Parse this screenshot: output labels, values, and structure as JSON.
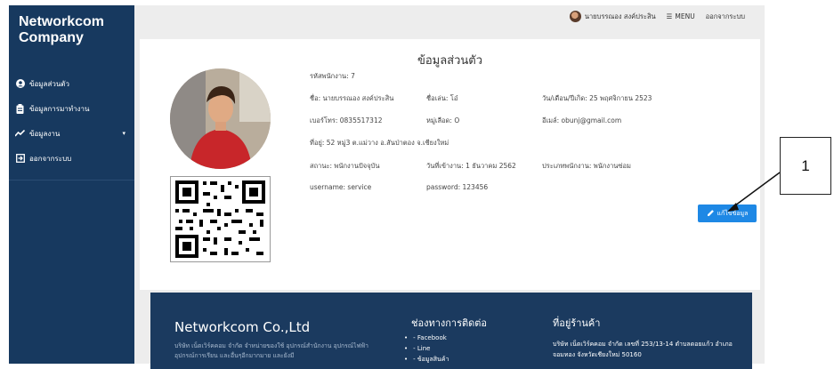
{
  "sidebar": {
    "brand_line1": "Networkcom",
    "brand_line2": "Company",
    "items": [
      {
        "label": "ข้อมูลส่วนตัว",
        "icon": "user-circle-icon"
      },
      {
        "label": "ข้อมูลการมาทำงาน",
        "icon": "clipboard-icon"
      },
      {
        "label": "ข้อมูลงาน",
        "icon": "chart-line-icon",
        "has_caret": true
      },
      {
        "label": "ออกจากระบบ",
        "icon": "sign-out-icon"
      }
    ]
  },
  "topbar": {
    "user_name": "นายบรรณอง สงค์ประสิน",
    "menu_label": "MENU",
    "logout_label": "ออกจากระบบ"
  },
  "profile": {
    "title": "ข้อมูลส่วนตัว",
    "employee_id": "รหัสพนักงาน: 7",
    "name": "ชื่อ: นายบรรณอง สงค์ประสิน",
    "nickname": "ชื่อเล่น: โอ๋",
    "birthdate": "วัน/เดือน/ปีเกิด: 25 พฤศจิกายน 2523",
    "phone": "เบอร์โทร: 0835517312",
    "blood": "หมู่เลือด: O",
    "email": "อีเมล์: obunj@gmail.com",
    "address": "ที่อยู่: 52 หมู่3 ต.แม่วาง อ.สันป่าตอง จ.เชียงใหม่",
    "status": "สถานะ: พนักงานปัจจุบัน",
    "start_date": "วันที่เข้างาน: 1 ธันวาคม 2562",
    "employee_type": "ประเภทพนักงาน: พนักงานซ่อม",
    "username": "username: service",
    "password": "password: 123456",
    "edit_button": "แก้ไขข้อมูล"
  },
  "footer": {
    "brand": "Networkcom Co.,Ltd",
    "desc": "บริษัท เน็ตเวิร์คคอม จำกัด จำหน่ายของใช้ อุปกรณ์สำนักงาน อุปกรณ์ไฟฟ้า อุปกรณ์การเรียน และอื่นๆอีกมากมาย และยังมี",
    "contact_title": "ช่องทางการติดต่อ",
    "contacts": [
      "- Facebook",
      "- Line",
      "- ข้อมูลสินค้า"
    ],
    "address_title": "ที่อยู่ร้านค้า",
    "address": "บริษัท เน็ตเวิร์คคอม จำกัด เลขที่ 253/13-14 ตำบลดอยแก้ว อำเภอจอมทอง จังหวัดเชียงใหม่ 50160"
  },
  "callout": {
    "label": "1"
  }
}
